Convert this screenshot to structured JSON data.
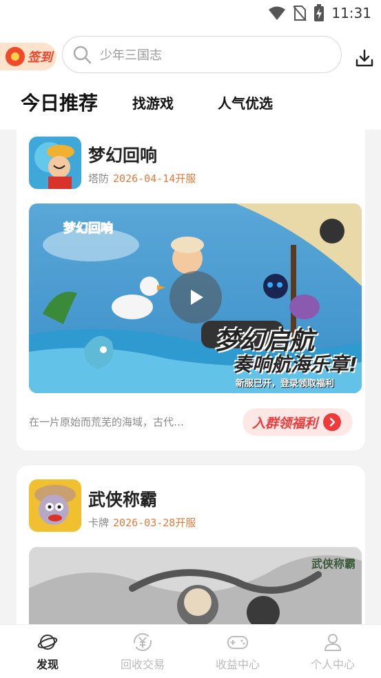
{
  "status_bar": {
    "time": "11:31"
  },
  "header": {
    "signin_label": "签到",
    "search_placeholder": "少年三国志"
  },
  "tabs": [
    {
      "label": "今日推荐",
      "active": true
    },
    {
      "label": "找游戏",
      "active": false
    },
    {
      "label": "人气优选",
      "active": false
    }
  ],
  "games": [
    {
      "title": "梦幻回响",
      "tag": "塔防",
      "date": "2026-04-14开服",
      "description": "在一片原始而荒芜的海域，古代…",
      "banner_text_1": "梦幻启航",
      "banner_text_2": "奏响航海乐章!",
      "banner_text_3": "新服已开，登录领取福利",
      "join_label": "入群领福利"
    },
    {
      "title": "武侠称霸",
      "tag": "卡牌",
      "date": "2026-03-28开服"
    }
  ],
  "bottom_nav": [
    {
      "label": "发现",
      "active": true,
      "icon": "planet-icon"
    },
    {
      "label": "回收交易",
      "active": false,
      "icon": "yen-recycle-icon"
    },
    {
      "label": "收益中心",
      "active": false,
      "icon": "gamepad-icon"
    },
    {
      "label": "个人中心",
      "active": false,
      "icon": "person-icon"
    }
  ],
  "colors": {
    "accent": "#e47a3c",
    "join_red": "#f03a3a",
    "signin_bg": "#fde3cc"
  }
}
